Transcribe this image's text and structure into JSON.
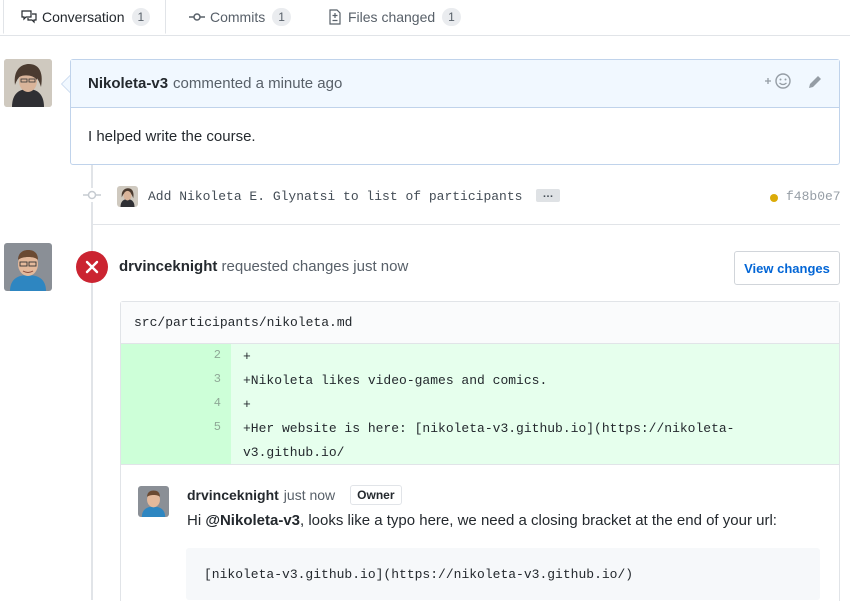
{
  "tabs": [
    {
      "label": "Conversation",
      "count": "1",
      "icon": "comment-discussion-icon"
    },
    {
      "label": "Commits",
      "count": "1",
      "icon": "git-commit-icon"
    },
    {
      "label": "Files changed",
      "count": "1",
      "icon": "file-diff-icon"
    }
  ],
  "comment": {
    "author": "Nikoleta-v3",
    "meta": "commented a minute ago",
    "body": "I helped write the course."
  },
  "commit": {
    "message": "Add Nikoleta E. Glynatsi to list of participants",
    "ellipsis": "…",
    "sha": "f48b0e7",
    "status_color": "#dbab09"
  },
  "review": {
    "author": "drvinceknight",
    "meta": "requested changes just now",
    "view_changes_label": "View changes",
    "status_color": "#cb2431"
  },
  "file": {
    "path": "src/participants/nikoleta.md",
    "lines": [
      {
        "num": "2",
        "text": "+"
      },
      {
        "num": "3",
        "text": "+Nikoleta likes video-games and comics."
      },
      {
        "num": "4",
        "text": "+"
      },
      {
        "num": "5",
        "text": "+Her website is here: [nikoleta-v3.github.io](https://nikoleta-"
      },
      {
        "num": "",
        "text": " v3.github.io/"
      }
    ]
  },
  "review_comment": {
    "author": "drvinceknight",
    "time": "just now",
    "badge": "Owner",
    "text_before": "Hi ",
    "mention": "@Nikoleta-v3",
    "text_after": ", looks like a typo here, we need a closing bracket at the end of your url:",
    "code": "[nikoleta-v3.github.io](https://nikoleta-v3.github.io/)"
  }
}
